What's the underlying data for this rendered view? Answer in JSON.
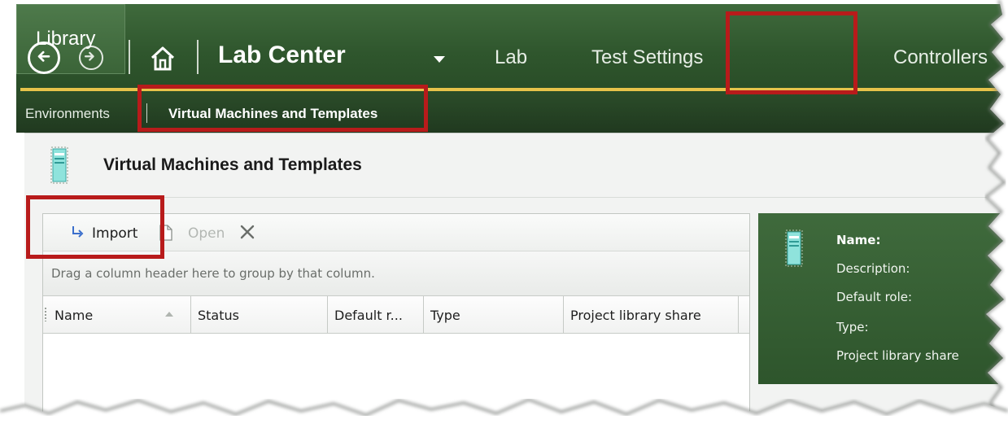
{
  "header": {
    "title": "Lab Center",
    "tabs": [
      {
        "label": "Lab"
      },
      {
        "label": "Test Settings"
      },
      {
        "label": "Library"
      },
      {
        "label": "Controllers"
      }
    ]
  },
  "subnav": {
    "items": [
      {
        "label": "Environments"
      },
      {
        "label": "Virtual Machines and Templates"
      }
    ]
  },
  "content": {
    "title": "Virtual Machines and Templates"
  },
  "toolbar": {
    "import_label": "Import",
    "open_label": "Open"
  },
  "grid": {
    "group_hint": "Drag a column header here to group by that column.",
    "columns": [
      "Name",
      "Status",
      "Default r...",
      "Type",
      "Project library share"
    ]
  },
  "details": {
    "name_label": "Name:",
    "description_label": "Description:",
    "default_role_label": "Default role:",
    "type_label": "Type:",
    "share_label": "Project library share"
  },
  "colors": {
    "nav_green": "#2f562d",
    "accent_yellow": "#e7c34a",
    "highlight_red": "#b81b1b"
  },
  "icons": [
    "back-icon",
    "forward-icon",
    "home-icon",
    "dropdown-icon",
    "vm-template-icon",
    "import-icon",
    "open-icon",
    "delete-icon",
    "sort-ascending-icon"
  ]
}
